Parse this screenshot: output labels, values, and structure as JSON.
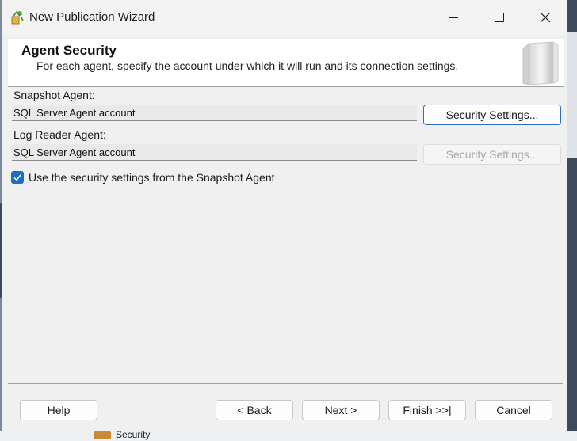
{
  "window": {
    "title": "New Publication Wizard"
  },
  "banner": {
    "title": "Agent Security",
    "subtitle": "For each agent, specify the account under which it will run and its connection settings."
  },
  "snapshot_agent": {
    "label": "Snapshot Agent:",
    "account": "SQL Server Agent account",
    "button": "Security Settings..."
  },
  "log_reader_agent": {
    "label": "Log Reader Agent:",
    "account": "SQL Server Agent account",
    "button": "Security Settings...",
    "button_enabled": false
  },
  "use_snapshot_settings": {
    "label": "Use the security settings from the Snapshot Agent",
    "checked": true
  },
  "footer": {
    "help": "Help",
    "back": "< Back",
    "next": "Next >",
    "finish": "Finish >>|",
    "cancel": "Cancel"
  },
  "background": {
    "tree_item": "Security"
  },
  "colors": {
    "accent": "#1c6fc2",
    "window_bg": "#f0f0f0",
    "banner_bg": "#ffffff"
  }
}
